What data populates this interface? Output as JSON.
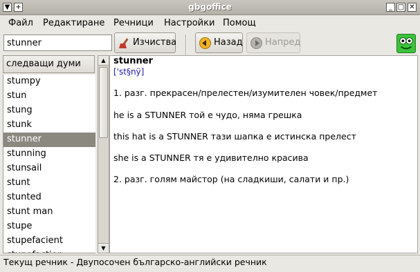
{
  "window": {
    "title": "gbgoffice",
    "btn_menu": "▼",
    "btn_stick": "+",
    "btn_minimize": "_",
    "btn_maximize": "□",
    "btn_close": "✕"
  },
  "menubar": {
    "file": "Файл",
    "edit": "Редактиране",
    "dictionaries": "Речници",
    "settings": "Настройки",
    "help": "Помощ"
  },
  "toolbar": {
    "search_value": "stunner",
    "clear_label": "Изчиства",
    "back_label": "Назад",
    "forward_label": "Напред"
  },
  "sidebar": {
    "header": "следващи думи",
    "items": [
      "stumpy",
      "stun",
      "stung",
      "stunk",
      "stunner",
      "stunning",
      "stunsail",
      "stunt",
      "stunted",
      "stunt man",
      "stupe",
      "stupefacient",
      "stupefaction"
    ],
    "selected_index": 4
  },
  "entry": {
    "headword": "stunner",
    "pronunciation": "['st§nÿ]",
    "lines": [
      "1. разг. прекрасен/прелестен/изумителен човек/предмет",
      "he is a STUNNER той е чудо, няма грешка",
      "this hat is a STUNNER тази шапка е истинска прелест",
      "she is a STUNNER тя е удивително красива",
      "2. разг. голям майстор (на сладкиши, салати и пр.)"
    ]
  },
  "status": {
    "text": "Текущ речник - Двупосочен българско-английски речник"
  },
  "colors": {
    "selection": "#8b8880",
    "pronunciation": "#1a1aa8",
    "logo": "#3cc23c"
  }
}
